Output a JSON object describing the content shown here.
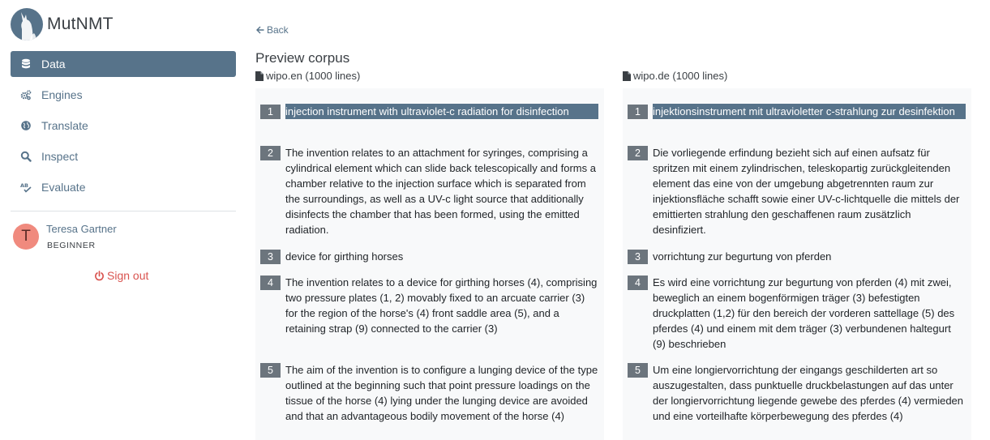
{
  "app": {
    "name": "MutNMT"
  },
  "nav": {
    "items": [
      {
        "label": "Data",
        "icon": "database-icon",
        "active": true
      },
      {
        "label": "Engines",
        "icon": "gears-icon",
        "active": false
      },
      {
        "label": "Translate",
        "icon": "globe-icon",
        "active": false
      },
      {
        "label": "Inspect",
        "icon": "search-icon",
        "active": false
      },
      {
        "label": "Evaluate",
        "icon": "spellcheck-icon",
        "active": false
      }
    ]
  },
  "user": {
    "initial": "T",
    "name": "Teresa Gartner",
    "role": "BEGINNER"
  },
  "signout": {
    "label": "Sign out"
  },
  "main": {
    "back_label": "Back",
    "title": "Preview corpus",
    "source_file": "wipo.en (1000 lines)",
    "target_file": "wipo.de (1000 lines)"
  },
  "segments": {
    "source": [
      {
        "n": "1",
        "text": "injection instrument with ultraviolet-c radiation for disinfection",
        "active": true
      },
      {
        "n": "2",
        "text": "The invention relates to an attachment for syringes, comprising a cylindrical element which can slide back telescopically and forms a chamber relative to the injection surface which is separated from the surroundings, as well as a UV-c light source that additionally disinfects the chamber that has been formed, using the emitted radiation."
      },
      {
        "n": "3",
        "text": "device for girthing horses"
      },
      {
        "n": "4",
        "text": "The invention relates to a device for girthing horses (4), comprising two pressure plates (1, 2) movably fixed to an arcuate carrier (3) for the region of the horse's (4) front saddle area (5), and a retaining strap (9) connected to the carrier (3)"
      },
      {
        "n": "5",
        "text": "The aim of the invention is to configure a lunging device of the type outlined at the beginning such that point pressure loadings on the tissue of the horse (4) lying under the lunging device are avoided and that an advantageous bodily movement of the horse (4)"
      }
    ],
    "target": [
      {
        "n": "1",
        "text": "injektionsinstrument mit ultravioletter c-strahlung zur desinfektion",
        "active": true
      },
      {
        "n": "2",
        "text": "Die vorliegende erfindung bezieht sich auf einen aufsatz für spritzen mit einem zylindrischen, teleskopartig zurückgleitenden element das eine von der umgebung abgetrennten raum zur injektionsfläche schafft sowie einer UV-c-lichtquelle die mittels der emittierten strahlung den geschaffenen raum zusätzlich desinfiziert."
      },
      {
        "n": "3",
        "text": "vorrichtung zur begurtung von pferden"
      },
      {
        "n": "4",
        "text": "Es wird eine vorrichtung zur begurtung von pferden (4) mit zwei, beweglich an einem bogenförmigen träger (3) befestigten druckplatten (1,2) für den bereich der vorderen sattellage (5) des pferdes (4) und einem mit dem träger (3) verbundenen haltegurt (9) beschrieben"
      },
      {
        "n": "5",
        "text": "Um eine longiervorrichtung der eingangs geschilderten art so auszugestalten, dass punktuelle druckbelastungen auf das unter der longiervorrichtung liegende gewebe des pferdes (4) vermieden und eine vorteilhafte körperbewegung des pferdes (4)"
      }
    ]
  },
  "colors": {
    "primary": "#57738a",
    "badge": "#6c757d",
    "danger": "#d9534f",
    "panel_bg": "#f8f9fa",
    "avatar": "#f08a7e"
  }
}
